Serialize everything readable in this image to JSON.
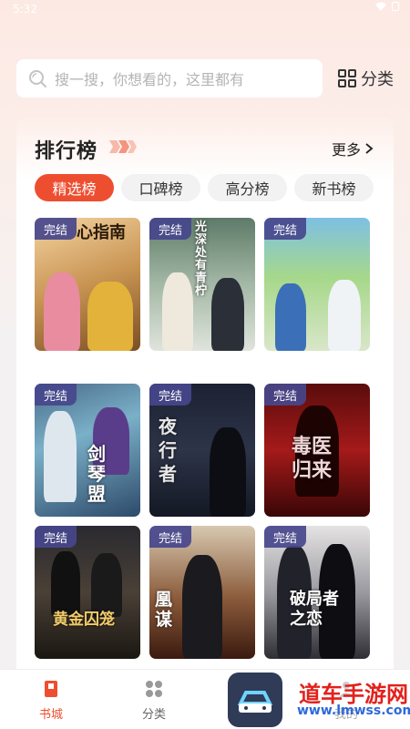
{
  "status_bar": {
    "time": "5:32"
  },
  "search": {
    "placeholder": "搜一搜，你想看的，这里都有",
    "category_label": "分类"
  },
  "ranking": {
    "title": "排行榜",
    "more_label": "更多",
    "tabs": [
      {
        "label": "精选榜",
        "active": true
      },
      {
        "label": "口碑榜",
        "active": false
      },
      {
        "label": "高分榜",
        "active": false
      },
      {
        "label": "新书榜",
        "active": false
      }
    ],
    "books": [
      {
        "badge": "完结",
        "cover_text": "心指南"
      },
      {
        "badge": "完结",
        "cover_text": "光深处有青柠"
      },
      {
        "badge": "完结",
        "cover_text": ""
      },
      {
        "badge": "完结",
        "cover_text": "剑琴盟"
      },
      {
        "badge": "完结",
        "cover_text": "夜行者"
      },
      {
        "badge": "完结",
        "cover_text": "毒医归来"
      },
      {
        "badge": "完结",
        "cover_text": "黄金囚笼"
      },
      {
        "badge": "完结",
        "cover_text": "凰谋"
      },
      {
        "badge": "完结",
        "cover_text": "破局者之恋"
      }
    ]
  },
  "bottom_nav": {
    "items": [
      {
        "label": "书城",
        "active": true
      },
      {
        "label": "分类",
        "active": false
      },
      {
        "label": "我的",
        "active": false
      }
    ]
  },
  "watermark": {
    "text": "道车手游网",
    "url": "www.lmwss.com"
  },
  "colors": {
    "accent": "#ee4e30",
    "badge": "#46468c"
  }
}
